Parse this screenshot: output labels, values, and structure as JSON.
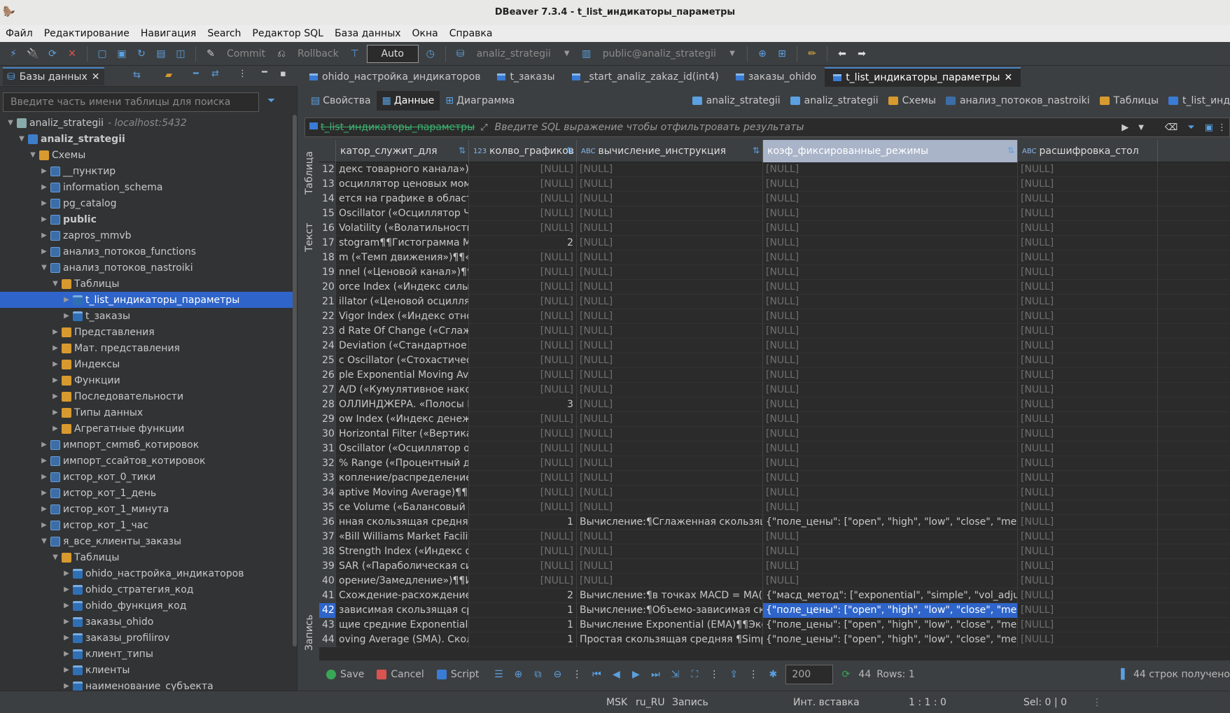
{
  "window": {
    "title": "DBeaver 7.3.4 - t_list_индикаторы_параметры"
  },
  "menu": [
    "Файл",
    "Редактирование",
    "Навигация",
    "Search",
    "Редактор SQL",
    "База данных",
    "Окна",
    "Справка"
  ],
  "toolbar": {
    "commit_label": "Commit",
    "rollback_label": "Rollback",
    "mode_label": "Auto",
    "datasource_label": "analiz_strategii",
    "schema_label": "public@analiz_strategii"
  },
  "left_panel": {
    "tab_label": "Базы данных",
    "search_placeholder": "Введите часть имени таблицы для поиска",
    "tree": [
      {
        "label": "analiz_strategii",
        "suffix": "- localhost:5432",
        "depth": 0,
        "arrow": "▼",
        "icon": "conn"
      },
      {
        "label": "analiz_strategii",
        "depth": 1,
        "arrow": "▼",
        "icon": "db",
        "bold": true
      },
      {
        "label": "Схемы",
        "depth": 2,
        "arrow": "▼",
        "icon": "folder"
      },
      {
        "label": "__пунктир",
        "depth": 3,
        "arrow": "▶",
        "icon": "schema"
      },
      {
        "label": "information_schema",
        "depth": 3,
        "arrow": "▶",
        "icon": "schema"
      },
      {
        "label": "pg_catalog",
        "depth": 3,
        "arrow": "▶",
        "icon": "schema"
      },
      {
        "label": "public",
        "depth": 3,
        "arrow": "▶",
        "icon": "schema",
        "bold": true
      },
      {
        "label": "zapros_mmvb",
        "depth": 3,
        "arrow": "▶",
        "icon": "schema"
      },
      {
        "label": "анализ_потоков_functions",
        "depth": 3,
        "arrow": "▶",
        "icon": "schema"
      },
      {
        "label": "анализ_потоков_nastroiki",
        "depth": 3,
        "arrow": "▼",
        "icon": "schema"
      },
      {
        "label": "Таблицы",
        "depth": 4,
        "arrow": "▼",
        "icon": "folder"
      },
      {
        "label": "t_list_индикаторы_параметры",
        "depth": 5,
        "arrow": "▶",
        "icon": "table",
        "selected": true
      },
      {
        "label": "t_заказы",
        "depth": 5,
        "arrow": "▶",
        "icon": "table"
      },
      {
        "label": "Представления",
        "depth": 4,
        "arrow": "▶",
        "icon": "folder"
      },
      {
        "label": "Мат. представления",
        "depth": 4,
        "arrow": "▶",
        "icon": "folder"
      },
      {
        "label": "Индексы",
        "depth": 4,
        "arrow": "▶",
        "icon": "folder"
      },
      {
        "label": "Функции",
        "depth": 4,
        "arrow": "▶",
        "icon": "folder"
      },
      {
        "label": "Последовательности",
        "depth": 4,
        "arrow": "▶",
        "icon": "folder"
      },
      {
        "label": "Типы данных",
        "depth": 4,
        "arrow": "▶",
        "icon": "folder"
      },
      {
        "label": "Агрегатные функции",
        "depth": 4,
        "arrow": "▶",
        "icon": "folder"
      },
      {
        "label": "импорт_смmвб_котировок",
        "depth": 3,
        "arrow": "▶",
        "icon": "schema"
      },
      {
        "label": "импорт_ссайтов_котировок",
        "depth": 3,
        "arrow": "▶",
        "icon": "schema"
      },
      {
        "label": "истор_кот_0_тики",
        "depth": 3,
        "arrow": "▶",
        "icon": "schema"
      },
      {
        "label": "истор_кот_1_день",
        "depth": 3,
        "arrow": "▶",
        "icon": "schema"
      },
      {
        "label": "истор_кот_1_минута",
        "depth": 3,
        "arrow": "▶",
        "icon": "schema"
      },
      {
        "label": "истор_кот_1_час",
        "depth": 3,
        "arrow": "▶",
        "icon": "schema"
      },
      {
        "label": "я_все_клиенты_заказы",
        "depth": 3,
        "arrow": "▼",
        "icon": "schema"
      },
      {
        "label": "Таблицы",
        "depth": 4,
        "arrow": "▼",
        "icon": "folder"
      },
      {
        "label": "ohido_настройка_индикаторов",
        "depth": 5,
        "arrow": "▶",
        "icon": "table"
      },
      {
        "label": "ohido_стратегия_код",
        "depth": 5,
        "arrow": "▶",
        "icon": "table"
      },
      {
        "label": "ohido_функция_код",
        "depth": 5,
        "arrow": "▶",
        "icon": "table"
      },
      {
        "label": "заказы_ohido",
        "depth": 5,
        "arrow": "▶",
        "icon": "table"
      },
      {
        "label": "заказы_profilirov",
        "depth": 5,
        "arrow": "▶",
        "icon": "table"
      },
      {
        "label": "клиент_типы",
        "depth": 5,
        "arrow": "▶",
        "icon": "table"
      },
      {
        "label": "клиенты",
        "depth": 5,
        "arrow": "▶",
        "icon": "table"
      },
      {
        "label": "наименование_субъекта",
        "depth": 5,
        "arrow": "▶",
        "icon": "table"
      }
    ]
  },
  "editor_tabs": [
    {
      "label": "ohido_настройка_индикаторов",
      "active": false
    },
    {
      "label": "t_заказы",
      "active": false
    },
    {
      "label": "_start_analiz_zakaz_id(int4)",
      "active": false
    },
    {
      "label": "заказы_ohido",
      "active": false
    },
    {
      "label": "t_list_индикаторы_параметры",
      "active": true
    }
  ],
  "sub_tabs": [
    "Свойства",
    "Данные",
    "Диаграмма"
  ],
  "breadcrumbs": [
    "analiz_strategii",
    "analiz_strategii",
    "Схемы",
    "анализ_потоков_nastroiki",
    "Таблицы",
    "t_list_инд"
  ],
  "filter": {
    "table_name": "t_list_индикаторы_параметры",
    "placeholder": "Введите SQL выражение чтобы отфильтровать результаты"
  },
  "side_labels": {
    "table": "Таблица",
    "text": "Текст",
    "record": "Запись"
  },
  "grid": {
    "columns": [
      {
        "label": "катор_служит_для",
        "type": ""
      },
      {
        "label": "колво_графиков",
        "type": "123"
      },
      {
        "label": "вычисление_инструкция",
        "type": "ABC"
      },
      {
        "label": "коэф_фиксированные_режимы",
        "type": ""
      },
      {
        "label": "расшифровка_стол",
        "type": "ABC"
      }
    ],
    "rows": [
      [
        "12",
        "декс товарного канала»)¶¶«Инде",
        "[NULL]",
        "[NULL]",
        "[NULL]",
        "[NULL]"
      ],
      [
        "13",
        "осциллятор ценовых моментов Ча",
        "[NULL]",
        "[NULL]",
        "[NULL]",
        "[NULL]"
      ],
      [
        "14",
        "ется на графике в область ЦЕНА.",
        "[NULL]",
        "[NULL]",
        "[NULL]",
        "[NULL]"
      ],
      [
        "15",
        "Oscillator («Осциллятор Чайкина»)",
        "[NULL]",
        "[NULL]",
        "[NULL]",
        "[NULL]"
      ],
      [
        "16",
        " Volatility («Волатильность Чайки",
        "[NULL]",
        "[NULL]",
        "[NULL]",
        "[NULL]"
      ],
      [
        "17",
        "stogram¶¶Гистограмма MACD стро",
        "2",
        "[NULL]",
        "[NULL]",
        "[NULL]"
      ],
      [
        "18",
        "m («Темп движения»)¶¶«Момент",
        "[NULL]",
        "[NULL]",
        "[NULL]",
        "[NULL]"
      ],
      [
        "19",
        "nnel («Ценовой канал»)¶¶Индика",
        "[NULL]",
        "[NULL]",
        "[NULL]",
        "[NULL]"
      ],
      [
        "20",
        "orce Index («Индекс силы Элдера»",
        "[NULL]",
        "[NULL]",
        "[NULL]",
        "[NULL]"
      ],
      [
        "21",
        "illator («Ценовой осциллятор»)¶¶",
        "[NULL]",
        "[NULL]",
        "[NULL]",
        "[NULL]"
      ],
      [
        "22",
        "Vigor Index («Индекс относительн",
        "[NULL]",
        "[NULL]",
        "[NULL]",
        "[NULL]"
      ],
      [
        "23",
        "d Rate Of Change («Сглаженная ск",
        "[NULL]",
        "[NULL]",
        "[NULL]",
        "[NULL]"
      ],
      [
        "24",
        " Deviation («Стандартное отклоне",
        "[NULL]",
        "[NULL]",
        "[NULL]",
        "[NULL]"
      ],
      [
        "25",
        "c Oscillator («Стохастический осц",
        "[NULL]",
        "[NULL]",
        "[NULL]",
        "[NULL]"
      ],
      [
        "26",
        "ple Exponential Moving Average»)¶",
        "[NULL]",
        "[NULL]",
        "[NULL]",
        "[NULL]"
      ],
      [
        "27",
        " A/D («Кумулятивное накопление",
        "[NULL]",
        "[NULL]",
        "[NULL]",
        "[NULL]"
      ],
      [
        "28",
        "ОЛЛИНДЖЕРА. «Полосы Боллинд:",
        "3",
        "[NULL]",
        "[NULL]",
        "[NULL]"
      ],
      [
        "29",
        "ow Index («Индекс денежных пот",
        "[NULL]",
        "[NULL]",
        "[NULL]",
        "[NULL]"
      ],
      [
        "30",
        "Horizontal Filter («Вертикально-гор",
        "[NULL]",
        "[NULL]",
        "[NULL]",
        "[NULL]"
      ],
      [
        "31",
        "Oscillator («Осциллятор объема»)¶",
        "[NULL]",
        "[NULL]",
        "[NULL]",
        "[NULL]"
      ],
      [
        "32",
        " % Range («Процентный диапазо",
        "[NULL]",
        "[NULL]",
        "[NULL]",
        "[NULL]"
      ],
      [
        "33",
        "копление/распределение»)¶¶Инд",
        "[NULL]",
        "[NULL]",
        "[NULL]",
        "[NULL]"
      ],
      [
        "34",
        "aptive Moving Average)¶¶Индикато",
        "[NULL]",
        "[NULL]",
        "[NULL]",
        "[NULL]"
      ],
      [
        "35",
        "ce Volume («Балансовый объем»)¶",
        "[NULL]",
        "[NULL]",
        "[NULL]",
        "[NULL]"
      ],
      [
        "36",
        "нная скользящая средняя ¶Smooth",
        "1",
        "Вычисление:¶Сглаженная скользящая ср",
        "{\"поле_цены\": [\"open\", \"high\", \"low\", \"close\", \"median\", \"typ",
        "[NULL]"
      ],
      [
        "37",
        "«Bill Williams Market Facilitation Inc",
        "[NULL]",
        "[NULL]",
        "[NULL]",
        "[NULL]"
      ],
      [
        "38",
        "Strength Index («Индекс относите",
        "[NULL]",
        "[NULL]",
        "[NULL]",
        "[NULL]"
      ],
      [
        "39",
        " SAR («Параболическая система»)",
        "[NULL]",
        "[NULL]",
        "[NULL]",
        "[NULL]"
      ],
      [
        "40",
        "орение/Замедление»)¶¶Индикато",
        "[NULL]",
        "[NULL]",
        "[NULL]",
        "[NULL]"
      ],
      [
        "41",
        "Схождение-расхождение скользя",
        "2",
        "Вычисление:¶в точках MACD = MA(P, Nshc",
        "{\"масд_метод\": [\"exponential\", \"simple\", \"vol_adjusted\", \"sm",
        "[NULL]"
      ],
      [
        "42",
        "зависимая скользящая средняя (\\",
        "1",
        "Вычисление:¶Объемо-зависимая скользя",
        "{\"поле_цены\": [\"open\", \"high\", \"low\", \"close\", \"median\", \"typ",
        "[NULL]"
      ],
      [
        "43",
        "щие средние Exponential (EMA):¶¶",
        "1",
        "Вычисление Exponential (EMA)¶¶Экспонен",
        "{\"поле_цены\": [\"open\", \"high\", \"low\", \"close\", \"median\", \"typ",
        "[NULL]"
      ],
      [
        "44",
        "oving Average (SMA). Скользящие",
        "1",
        "Простая скользящая средняя ¶Simple Mov",
        "{\"поле_цены\": [\"open\", \"high\", \"low\", \"close\", \"median\", \"typ",
        "[NULL]"
      ]
    ],
    "selected_row": "42"
  },
  "footer": {
    "save_label": "Save",
    "cancel_label": "Cancel",
    "script_label": "Script",
    "fetch_size": "200",
    "count": "44",
    "rows_label": "Rows: 1",
    "result_text": "44 строк получено"
  },
  "status": {
    "timezone": "MSK",
    "locale": "ru_RU",
    "mode": "Запись",
    "insert_mode": "Инт. вставка",
    "position": "1 : 1 : 0",
    "selection": "Sel: 0 | 0"
  },
  "colors": {
    "accent": "#2f65ca",
    "background": "#2b2b2b",
    "panel": "#3c3f41"
  }
}
